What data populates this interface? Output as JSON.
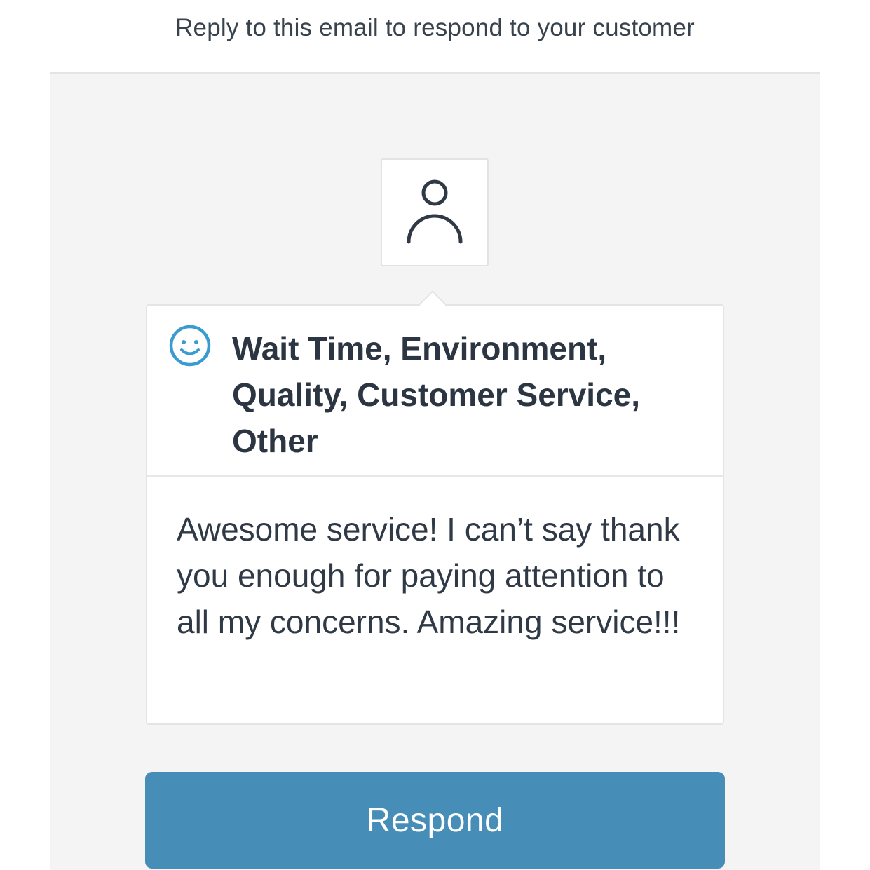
{
  "header": {
    "notice": "Reply to this email to respond to your customer"
  },
  "feedback": {
    "avatar_icon": "person-icon",
    "sentiment_icon": "smiley-face-icon",
    "sentiment_color": "#3a9bd0",
    "categories": "Wait Time, Environment, Quality, Customer Service, Other",
    "comment": "Awesome service! I can’t say thank you enough for paying attention to all my concerns. Amazing service!!!"
  },
  "actions": {
    "respond_label": "Respond",
    "respond_color": "#468db7"
  }
}
